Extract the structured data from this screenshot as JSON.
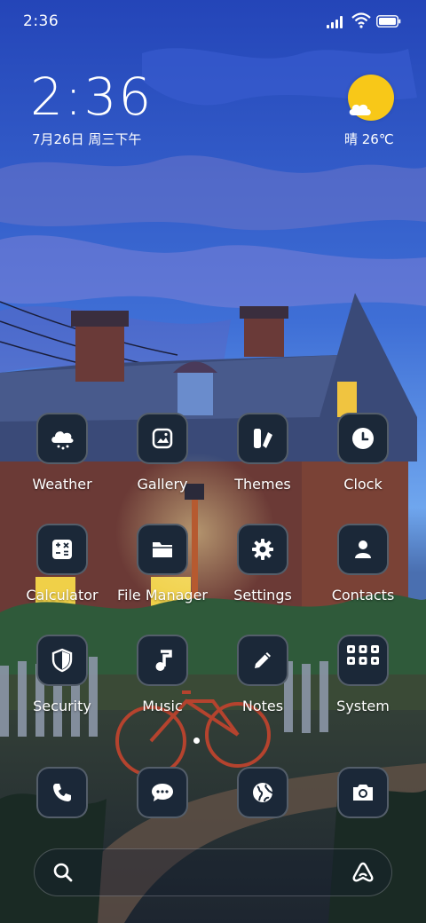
{
  "status_bar": {
    "time": "2:36"
  },
  "clock_widget": {
    "time": "2:36",
    "date": "7月26日 周三下午"
  },
  "weather_widget": {
    "text": "晴 26℃",
    "icon": "sun-cloud-icon"
  },
  "apps_row1": [
    {
      "label": "Weather",
      "icon": "weather-icon"
    },
    {
      "label": "Gallery",
      "icon": "gallery-icon"
    },
    {
      "label": "Themes",
      "icon": "themes-icon"
    },
    {
      "label": "Clock",
      "icon": "clock-icon"
    }
  ],
  "apps_row2": [
    {
      "label": "Calculator",
      "icon": "calculator-icon"
    },
    {
      "label": "File Manager",
      "icon": "folder-icon"
    },
    {
      "label": "Settings",
      "icon": "gear-icon"
    },
    {
      "label": "Contacts",
      "icon": "contacts-icon"
    }
  ],
  "apps_row3": [
    {
      "label": "Security",
      "icon": "shield-icon"
    },
    {
      "label": "Music",
      "icon": "music-note-icon"
    },
    {
      "label": "Notes",
      "icon": "pencil-icon"
    },
    {
      "label": "System",
      "icon": "folder-grid-icon"
    }
  ],
  "dock": [
    {
      "icon": "phone-icon"
    },
    {
      "icon": "message-icon"
    },
    {
      "icon": "globe-icon"
    },
    {
      "icon": "camera-icon"
    }
  ],
  "search_bar": {
    "icon": "search-icon",
    "assistant_icon": "assistant-icon"
  },
  "colors": {
    "icon_bg": "#1b2838",
    "sun": "#f8c818",
    "sky_top": "#2a4fc0",
    "sky_bottom": "#5a8ee8"
  }
}
